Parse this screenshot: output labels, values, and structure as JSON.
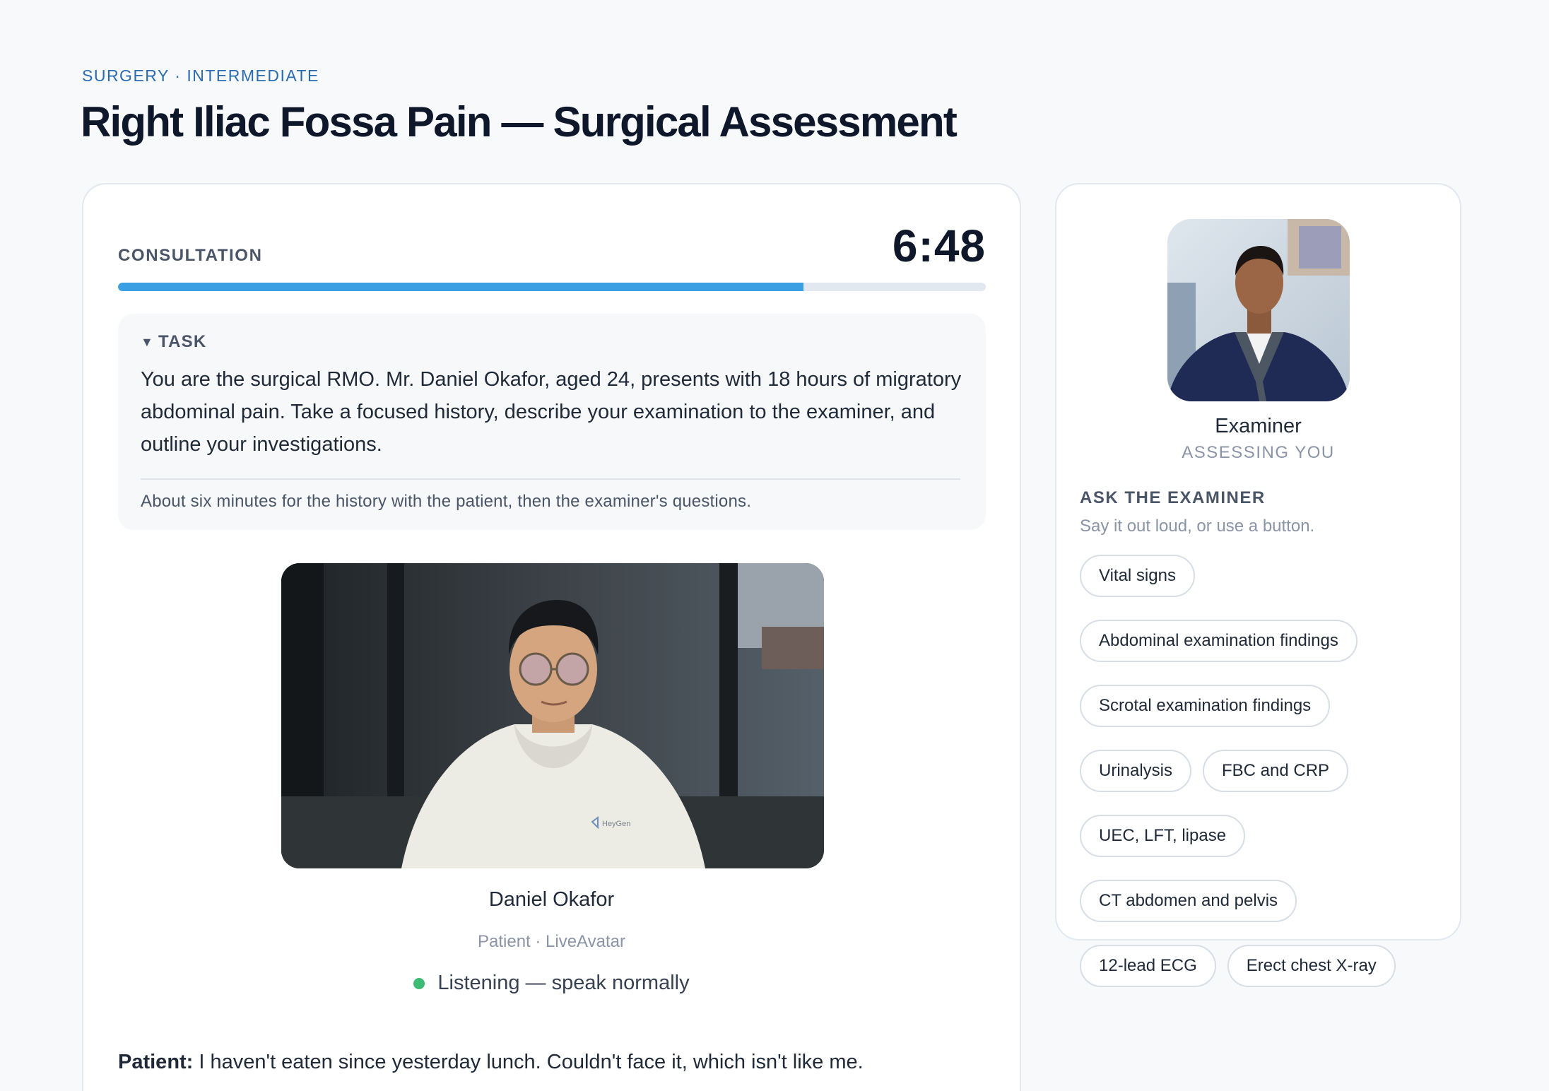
{
  "header": {
    "breadcrumb": "SURGERY · INTERMEDIATE",
    "title": "Right Iliac Fossa Pain — Surgical Assessment"
  },
  "consultation": {
    "label": "CONSULTATION",
    "timer": "6:48",
    "progress": 0.79,
    "task": {
      "heading": "TASK",
      "body": "You are the surgical RMO. Mr. Daniel Okafor, aged 24, presents with 18 hours of migratory abdominal pain. Take a focused history, describe your examination to the examiner, and outline your investigations.",
      "note": "About six minutes for the history with the patient, then the examiner's questions."
    },
    "patient": {
      "name": "Daniel Okafor",
      "subtitle": "Patient · LiveAvatar",
      "status": "Listening — speak normally",
      "video_label": "HeyGen"
    },
    "transcript": {
      "speaker": "Patient:",
      "text": " I haven't eaten since yesterday lunch. Couldn't face it, which isn't like me."
    }
  },
  "examiner": {
    "name": "Examiner",
    "role": "ASSESSING YOU",
    "ask_heading": "ASK THE EXAMINER",
    "ask_subtitle": "Say it out loud, or use a button.",
    "buttons": [
      "Vital signs",
      "Abdominal examination findings",
      "Scrotal examination findings",
      "Urinalysis",
      "FBC and CRP",
      "UEC, LFT, lipase",
      "CT abdomen and pelvis",
      "12-lead ECG",
      "Erect chest X-ray"
    ]
  },
  "colors": {
    "accent": "#3b9fe3",
    "listening": "#3dba75",
    "breadcrumb": "#2b6cb0"
  }
}
